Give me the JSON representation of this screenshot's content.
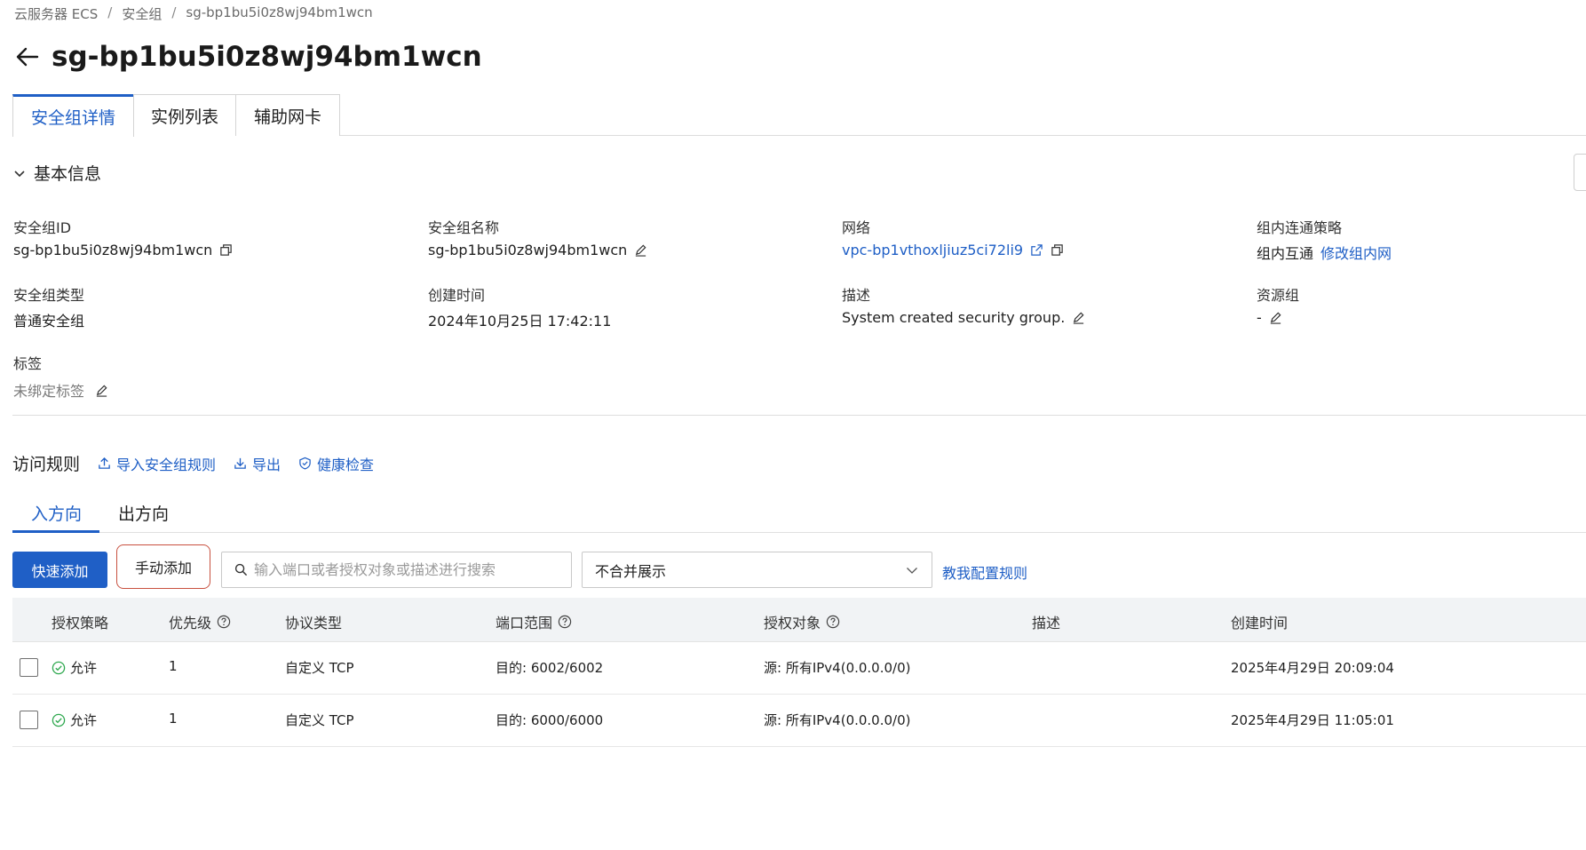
{
  "breadcrumb": [
    "云服务器 ECS",
    "安全组",
    "sg-bp1bu5i0z8wj94bm1wcn"
  ],
  "breadcrumb_sep": "/",
  "page": {
    "title": "sg-bp1bu5i0z8wj94bm1wcn"
  },
  "tabs": [
    {
      "label": "安全组详情",
      "active": true
    },
    {
      "label": "实例列表",
      "active": false
    },
    {
      "label": "辅助网卡",
      "active": false
    }
  ],
  "basic_info": {
    "heading": "基本信息",
    "fields": {
      "sg_id": {
        "label": "安全组ID",
        "value": "sg-bp1bu5i0z8wj94bm1wcn"
      },
      "sg_name": {
        "label": "安全组名称",
        "value": "sg-bp1bu5i0z8wj94bm1wcn"
      },
      "network": {
        "label": "网络",
        "value": "vpc-bp1vthoxljiuz5ci72li9"
      },
      "policy": {
        "label": "组内连通策略",
        "value": "组内互通",
        "link": "修改组内网"
      },
      "sg_type": {
        "label": "安全组类型",
        "value": "普通安全组"
      },
      "created": {
        "label": "创建时间",
        "value": "2024年10月25日 17:42:11"
      },
      "desc": {
        "label": "描述",
        "value": "System created security group."
      },
      "resource_group": {
        "label": "资源组",
        "value": "-"
      },
      "tags": {
        "label": "标签",
        "value": "未绑定标签"
      }
    }
  },
  "rules": {
    "title": "访问规则",
    "actions": {
      "import": "导入安全组规则",
      "export": "导出",
      "health": "健康检查"
    },
    "directions": [
      {
        "label": "入方向",
        "active": true
      },
      {
        "label": "出方向",
        "active": false
      }
    ],
    "toolbar": {
      "quick_add": "快速添加",
      "manual_add": "手动添加",
      "search_placeholder": "输入端口或者授权对象或描述进行搜索",
      "merge_select": "不合并展示",
      "help_link": "教我配置规则"
    },
    "columns": [
      "授权策略",
      "优先级",
      "协议类型",
      "端口范围",
      "授权对象",
      "描述",
      "创建时间"
    ],
    "rows": [
      {
        "policy": "允许",
        "priority": "1",
        "protocol": "自定义 TCP",
        "port": "目的: 6002/6002",
        "target": "源: 所有IPv4(0.0.0.0/0)",
        "desc": "",
        "created": "2025年4月29日 20:09:04"
      },
      {
        "policy": "允许",
        "priority": "1",
        "protocol": "自定义 TCP",
        "port": "目的: 6000/6000",
        "target": "源: 所有IPv4(0.0.0.0/0)",
        "desc": "",
        "created": "2025年4月29日 11:05:01"
      }
    ]
  },
  "colors": {
    "accent": "#1f5fc6",
    "highlight_border": "#c8503f",
    "ok_green": "#2fa84f"
  }
}
